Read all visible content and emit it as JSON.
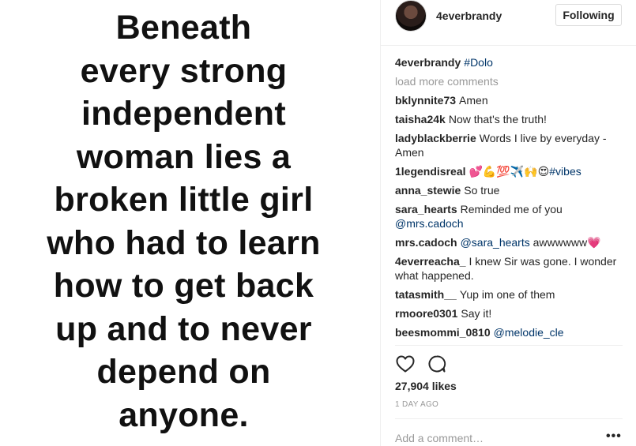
{
  "post": {
    "quote_lines": [
      "Beneath",
      "every strong",
      "independent",
      "woman lies a",
      "broken little girl",
      "who had to learn",
      "how to get back",
      "up and to never",
      "depend on",
      "anyone."
    ]
  },
  "header": {
    "username": "4everbrandy",
    "follow_label": "Following",
    "avatar_icon": "profile-avatar"
  },
  "caption": {
    "user": "4everbrandy",
    "text": "#Dolo"
  },
  "load_more": "load more comments",
  "comments": [
    {
      "user": "bklynnite73",
      "text": "Amen"
    },
    {
      "user": "taisha24k",
      "text": "Now that's the truth!"
    },
    {
      "user": "ladyblackberrie",
      "text": "Words I live by everyday - Amen"
    },
    {
      "user": "1legendisreal",
      "text": "💕💪💯✈️🙌😍",
      "tag": "#vibes"
    },
    {
      "user": "anna_stewie",
      "text": "So true"
    },
    {
      "user": "sara_hearts",
      "text": "Reminded me of you",
      "mention": "@mrs.cadoch"
    },
    {
      "user": "mrs.cadoch",
      "mention": "@sara_hearts",
      "text": "awwwwww💗"
    },
    {
      "user": "4everreacha_",
      "text": "I knew Sir was gone. I wonder what happened."
    },
    {
      "user": "tatasmith__",
      "text": "Yup im one of them"
    },
    {
      "user": "rmoore0301",
      "text": "Say it!"
    },
    {
      "user": "beesmommi_0810",
      "mention": "@melodie_cle"
    }
  ],
  "actions": {
    "like_icon": "heart-icon",
    "comment_icon": "comment-bubble-icon"
  },
  "likes": "27,904 likes",
  "time": "1 DAY AGO",
  "add_comment_placeholder": "Add a comment…",
  "more_label": "•••",
  "colors": {
    "link": "#003569",
    "muted": "#999999",
    "text": "#262626",
    "divider": "#efefef"
  }
}
